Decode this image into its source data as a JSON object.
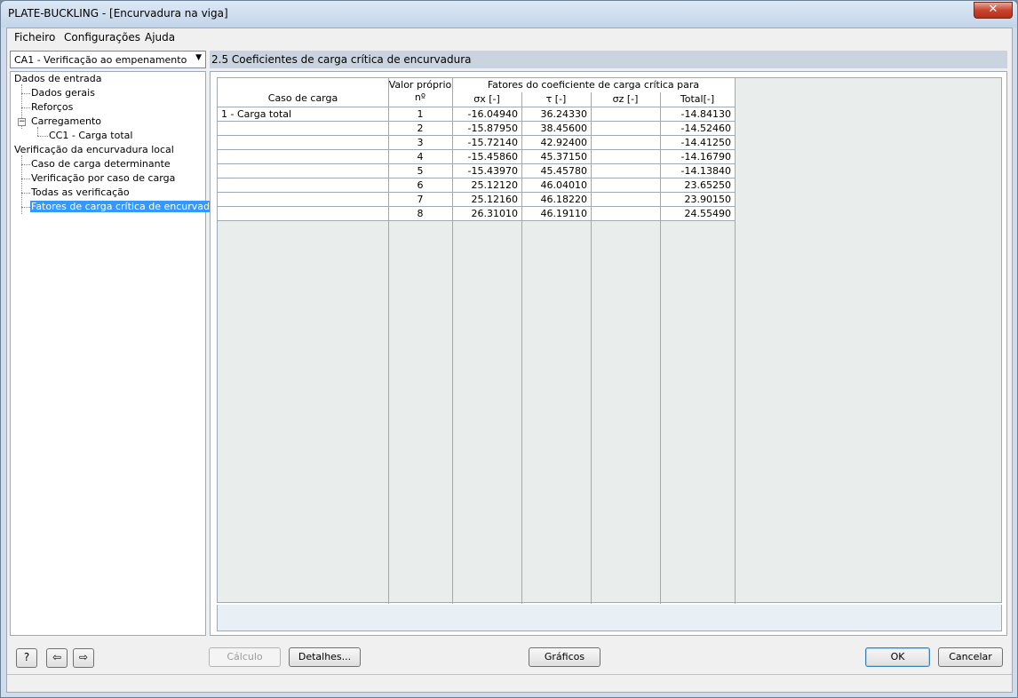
{
  "window": {
    "title": "PLATE-BUCKLING - [Encurvadura na viga]",
    "close_glyph": "✕"
  },
  "menu": [
    "Ficheiro",
    "Configurações",
    "Ajuda"
  ],
  "case_select": {
    "value": "CA1 - Verificação ao empenamento",
    "arrow": "▼"
  },
  "tree": {
    "root_input": "Dados de entrada",
    "general": "Dados gerais",
    "stiffeners": "Reforços",
    "loading": "Carregamento",
    "loading_expander": "−",
    "lc1": "CC1 - Carga total",
    "root_check": "Verificação da encurvadura local",
    "governing": "Caso de carga determinante",
    "by_case": "Verificação por caso de carga",
    "all_checks": "Todas as verificação",
    "factors": "Fatores de carga crítica de encurvadura"
  },
  "section_title": "2.5 Coeficientes de carga crítica de encurvadura",
  "table": {
    "headers": {
      "load_case": "Caso de carga",
      "eigen_top": "Valor próprio",
      "eigen_bottom": "nº",
      "group": "Fatores do coeficiente de carga crítica para",
      "sigma_x": "σx [-]",
      "tau": "τ [-]",
      "sigma_z": "σz [-]",
      "total": "Total[-]"
    },
    "rows": [
      {
        "case": "1 - Carga total",
        "n": "1",
        "sx": "-16.04940",
        "tau": "36.24330",
        "sz": "",
        "total": "-14.84130"
      },
      {
        "case": "",
        "n": "2",
        "sx": "-15.87950",
        "tau": "38.45600",
        "sz": "",
        "total": "-14.52460"
      },
      {
        "case": "",
        "n": "3",
        "sx": "-15.72140",
        "tau": "42.92400",
        "sz": "",
        "total": "-14.41250"
      },
      {
        "case": "",
        "n": "4",
        "sx": "-15.45860",
        "tau": "45.37150",
        "sz": "",
        "total": "-14.16790"
      },
      {
        "case": "",
        "n": "5",
        "sx": "-15.43970",
        "tau": "45.45780",
        "sz": "",
        "total": "-14.13840"
      },
      {
        "case": "",
        "n": "6",
        "sx": "25.12120",
        "tau": "46.04010",
        "sz": "",
        "total": "23.65250"
      },
      {
        "case": "",
        "n": "7",
        "sx": "25.12160",
        "tau": "46.18220",
        "sz": "",
        "total": "23.90150"
      },
      {
        "case": "",
        "n": "8",
        "sx": "26.31010",
        "tau": "46.19110",
        "sz": "",
        "total": "24.55490"
      }
    ]
  },
  "buttons": {
    "help": "?",
    "import": "⇦",
    "export": "⇨",
    "calc": "Cálculo",
    "details": "Detalhes...",
    "graphics": "Gráficos",
    "ok": "OK",
    "cancel": "Cancelar"
  }
}
